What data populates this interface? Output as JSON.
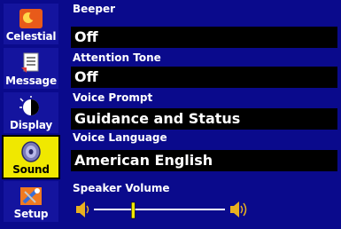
{
  "sidebar": {
    "tabs": [
      {
        "label": "Celestial",
        "icon": "celestial-icon"
      },
      {
        "label": "Message",
        "icon": "message-icon"
      },
      {
        "label": "Display",
        "icon": "display-icon"
      },
      {
        "label": "Sound",
        "icon": "speaker-icon",
        "selected": true
      },
      {
        "label": "Setup",
        "icon": "setup-tools-icon"
      }
    ]
  },
  "settings": {
    "beeper": {
      "label": "Beeper",
      "value": "Off"
    },
    "attention_tone": {
      "label": "Attention Tone",
      "value": "Off"
    },
    "voice_prompt": {
      "label": "Voice Prompt",
      "value": "Guidance and Status"
    },
    "voice_language": {
      "label": "Voice Language",
      "value": "American English"
    },
    "speaker_volume": {
      "label": "Speaker Volume",
      "level": 0.3
    }
  },
  "colors": {
    "background": "#0a0a8c",
    "selected_tab": "#f0e800",
    "value_field": "#000000",
    "text": "#ffffff"
  }
}
